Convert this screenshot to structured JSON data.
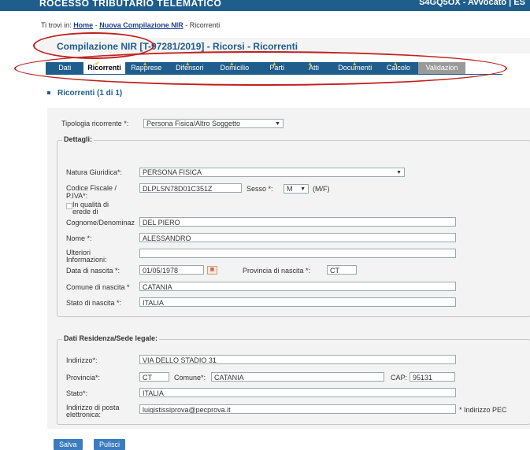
{
  "header": {
    "app_title": "ROCESSO TRIBUTARIO TELEMATICO",
    "user": "S4GQ5OX - Avvocato | ES"
  },
  "breadcrumb": {
    "prefix": "Ti trovi in:",
    "home": "Home",
    "sep1": " - ",
    "nir": "Nuova Compilazione NIR",
    "sep2": " - ",
    "current": "Ricorrenti"
  },
  "page_title": "Compilazione NIR [T-97281/2019] - Ricorsi - Ricorrenti",
  "tabs": [
    "Dati",
    "Ricorrenti",
    "Rapprese",
    "Difensori",
    "Domicilio",
    "Parti",
    "Atti",
    "Documenti",
    "Calcolo",
    "Validazion"
  ],
  "section": {
    "title": "Ricorrenti (1 di 1)"
  },
  "form": {
    "tipologia_label": "Tipologia ricorrente *:",
    "tipologia_value": "Persona Fisica/Altro Soggetto",
    "dettagli_legend": "Dettagli:",
    "natura_label": "Natura Giuridica*:",
    "natura_value": "PERSONA FISICA",
    "cf_label": "Codice Fiscale / P.IVA*:",
    "cf_value": "DLPLSN78D01C351Z",
    "sesso_label": "Sesso *:",
    "sesso_value": "M",
    "sesso_hint": "(M/F)",
    "erede_label": "In qualità di erede di",
    "cognome_label": "Cognome/Denominaz",
    "cognome_value": "DEL PIERO",
    "nome_label": "Nome *:",
    "nome_value": "ALESSANDRO",
    "ulteriori_label": "Ulteriori Informazioni:",
    "ulteriori_value": "",
    "data_label": "Data di nascita *:",
    "data_value": "01/05/1978",
    "prov_nascita_label": "Provincia di nascita *:",
    "prov_nascita_value": "CT",
    "comune_nascita_label": "Comune di nascita *",
    "comune_nascita_value": "CATANIA",
    "stato_nascita_label": "Stato di nascita *:",
    "stato_nascita_value": "ITALIA",
    "residenza_legend": "Dati Residenza/Sede legale:",
    "indirizzo_label": "Indirizzo*:",
    "indirizzo_value": "VIA DELLO STADIO 31",
    "provincia_label": "Provincia*:",
    "provincia_value": "CT",
    "comune_label": "Comune*:",
    "comune_value": "CATANIA",
    "cap_label": "CAP:",
    "cap_value": "95131",
    "stato_label": "Stato*:",
    "stato_value": "ITALIA",
    "pec_label": "Indirizzo di posta elettronica:",
    "pec_value": "luigistissiprova@pecprova.it",
    "pec_hint": "* Indirizzo PEC"
  },
  "buttons": {
    "save": "Salva",
    "clear": "Pulisci"
  }
}
